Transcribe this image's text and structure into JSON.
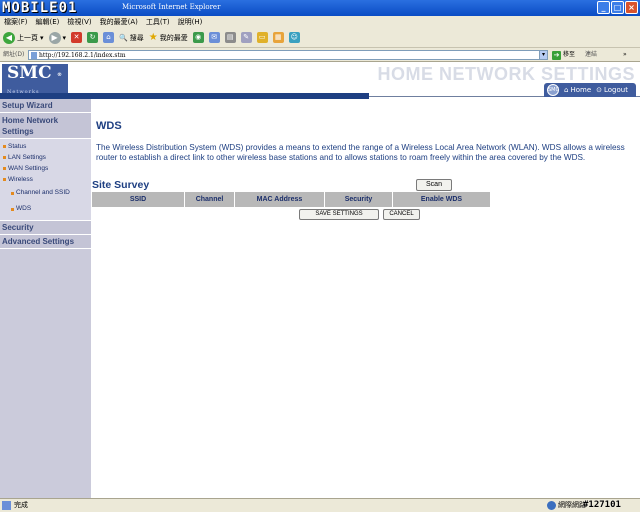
{
  "browser": {
    "watermark": "MOBILE01",
    "window_title": "Microsoft Internet Explorer",
    "menu": [
      "檔案(F)",
      "編輯(E)",
      "檢視(V)",
      "我的最愛(A)",
      "工具(T)",
      "說明(H)"
    ],
    "toolbar": {
      "back_label": "上一頁",
      "search_label": "搜尋",
      "favorites_label": "我的最愛"
    },
    "address": {
      "label": "網址(D)",
      "url": "http://192.168.2.1/index.stm",
      "go_label": "移至",
      "links_label": "連結"
    },
    "status": {
      "text": "完成",
      "zone": "網際網路",
      "post_id": "#127101"
    }
  },
  "router": {
    "logo": "SMC",
    "logo_reg": "®",
    "logo_sub": "Networks",
    "header_title": "HOME NETWORK SETTINGS",
    "nav_home": "Home",
    "nav_logout": "Logout",
    "sidebar": {
      "setup_wizard": "Setup Wizard",
      "home_network_settings": "Home Network Settings",
      "items": [
        "Status",
        "LAN Settings",
        "WAN Settings",
        "Wireless"
      ],
      "wireless_sub": [
        "Channel and SSID",
        "WDS"
      ],
      "security": "Security",
      "advanced_settings": "Advanced Settings"
    },
    "content": {
      "title": "WDS",
      "description": "The Wireless Distribution System (WDS) provides a means to extend the range of a Wireless Local Area Network (WLAN). WDS allows a wireless router to establish a direct link to other wireless base stations and to allows stations to roam freely within the area covered by the WDS.",
      "survey_title": "Site Survey",
      "scan_label": "Scan",
      "table_headers": [
        "SSID",
        "Channel",
        "MAC Address",
        "Security",
        "Enable WDS"
      ],
      "save_label": "SAVE SETTINGS",
      "cancel_label": "CANCEL"
    }
  },
  "colors": {
    "brand_blue": "#1e3f82",
    "logo_blue": "#3f5c9e",
    "sidebar_bg": "#cbcbdb",
    "bullet_orange": "#e48a1e",
    "table_header_bg": "#b8b8b8"
  },
  "icons": [
    "back-icon",
    "forward-icon",
    "stop-icon",
    "refresh-icon",
    "home-icon",
    "search-icon",
    "favorites-icon",
    "media-icon",
    "mail-icon",
    "print-icon",
    "edit-icon",
    "messenger-icon"
  ]
}
